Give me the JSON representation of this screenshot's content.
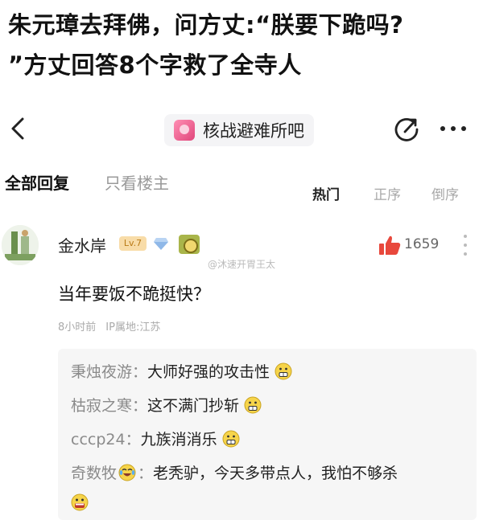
{
  "headline": {
    "line1": "朱元璋去拜佛，问方丈:“朕要下跪吗?",
    "line2": "”方丈回答8个字救了全寺人"
  },
  "navbar": {
    "forum_name": "核战避难所吧",
    "icons": {
      "back": "back-chevron-icon",
      "share": "share-icon",
      "more": "more-icon"
    }
  },
  "filters": {
    "all_replies": "全部回复",
    "only_owner": "只看楼主",
    "sort": {
      "hot": "热门",
      "asc": "正序",
      "desc": "倒序"
    }
  },
  "comment": {
    "username": "金水岸",
    "level": "Lv.7",
    "likes": "1659",
    "text": "当年要饭不跪挺快？",
    "time": "8小时前",
    "location": "IP属地:江苏",
    "watermark": "@沐速开胃王太"
  },
  "replies": [
    {
      "name": "秉烛夜游：",
      "text": "大师好强的攻击性",
      "emoji": "grimace-emoji"
    },
    {
      "name": "枯寂之寒：",
      "text": "这不满门抄斩",
      "emoji": "grimace-emoji"
    },
    {
      "name": "cccp24：",
      "text": "九族消消乐",
      "emoji": "grimace-emoji"
    },
    {
      "name": "奇数牧",
      "name_emoji": "laugh-cry-emoji",
      "sep": "：",
      "text": "老秃驴，今天多带点人，我怕不够杀"
    }
  ],
  "colors": {
    "like_red": "#e8483c",
    "level_bg": "#f8dca8",
    "reply_bg": "#f6f6f6",
    "forum_pink": "#e0467b"
  }
}
